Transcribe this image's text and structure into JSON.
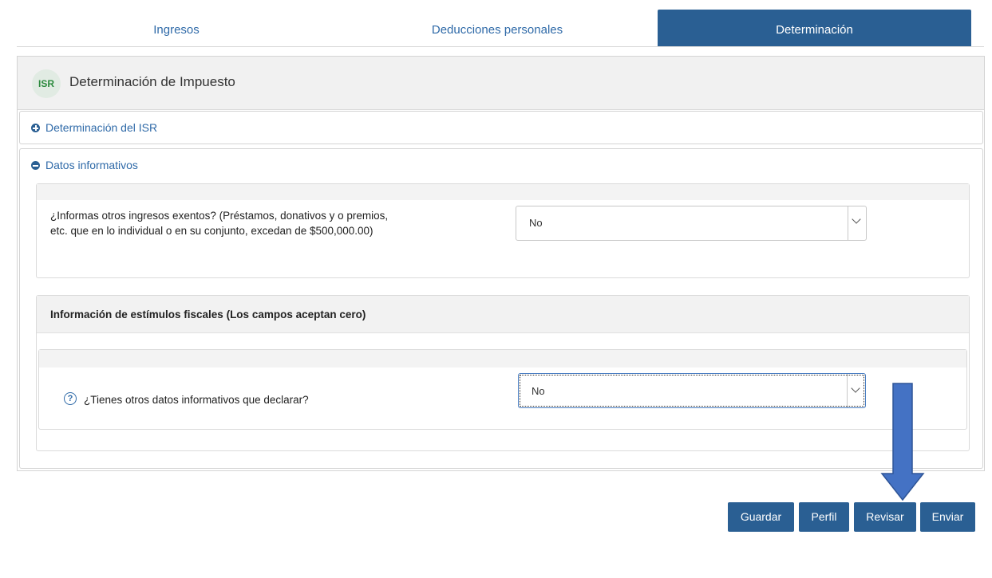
{
  "tabs": [
    {
      "label": "Ingresos",
      "active": false
    },
    {
      "label": "Deducciones personales",
      "active": false
    },
    {
      "label": "Determinación",
      "active": true
    }
  ],
  "header": {
    "badge": "ISR",
    "title": "Determinación de Impuesto"
  },
  "sections": {
    "isr": {
      "label": "Determinación del ISR",
      "icon": "plus-circle-icon",
      "expanded": false
    },
    "datos": {
      "label": "Datos informativos",
      "icon": "minus-circle-icon",
      "expanded": true
    }
  },
  "exempt_income": {
    "question": "¿Informas otros ingresos exentos? (Préstamos, donativos y o premios, etc. que en lo individual o en su conjunto, excedan de $500,000.00)",
    "value": "No"
  },
  "fiscal_stimulus": {
    "title": "Información de estímulos fiscales (Los campos aceptan cero)",
    "help_icon": "question-circle-icon",
    "question": "¿Tienes otros datos informativos que declarar?",
    "value": "No"
  },
  "annotation": {
    "icon": "down-arrow-icon",
    "color": "#4472c4"
  },
  "buttons": {
    "save": "Guardar",
    "profile": "Perfil",
    "review": "Revisar",
    "send": "Enviar"
  },
  "colors": {
    "primary": "#2a5f93",
    "link": "#2f6aa8",
    "badge_text": "#2c8a3e"
  }
}
